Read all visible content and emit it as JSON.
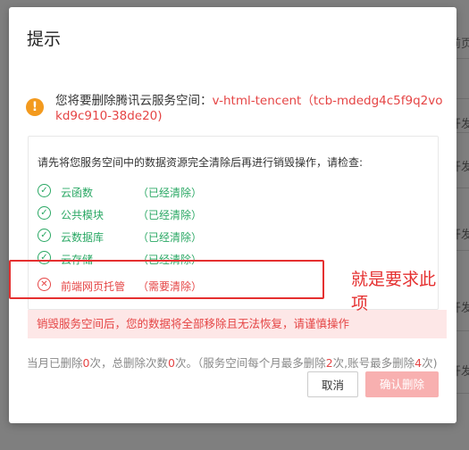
{
  "background": {
    "row_texts": [
      "前页",
      "开发",
      "开发",
      "开",
      "开发",
      "开发",
      "开发"
    ]
  },
  "dialog": {
    "title": "提示",
    "warning": {
      "icon": "exclamation-icon",
      "prefix": "您将要删除腾讯云服务空间：",
      "env_name": "v-html-tencent（tcb-mdedg4c5f9q2vokd9c910-38de20)"
    },
    "checklist": {
      "intro": "请先将您服务空间中的数据资源完全清除后再进行销毁操作，请检查:",
      "items": [
        {
          "name": "云函数",
          "status": "（已经清除）",
          "state": "ok"
        },
        {
          "name": "公共模块",
          "status": "（已经清除）",
          "state": "ok"
        },
        {
          "name": "云数据库",
          "status": "（已经清除）",
          "state": "ok"
        },
        {
          "name": "云存储",
          "status": "（已经清除）",
          "state": "ok"
        },
        {
          "name": "前端网页托管",
          "status": "（需要清除）",
          "state": "bad"
        }
      ]
    },
    "alert": "销毁服务空间后，您的数据将全部移除且无法恢复，请谨慎操作",
    "counts": {
      "t1": "当月已删除",
      "n1": "0",
      "t2": "次，总删除次数",
      "n2": "0",
      "t3": "次。（服务空间每个月最多删除",
      "n3": "2",
      "t4": "次,账号最多删除",
      "n4": "4",
      "t5": "次)"
    },
    "buttons": {
      "cancel": "取消",
      "confirm": "确认删除"
    }
  },
  "annotation": {
    "text": "就是要求此项",
    "color": "#e53030"
  },
  "colors": {
    "ok": "#2aa864",
    "bad": "#e54545",
    "warning": "#f39a1e"
  }
}
